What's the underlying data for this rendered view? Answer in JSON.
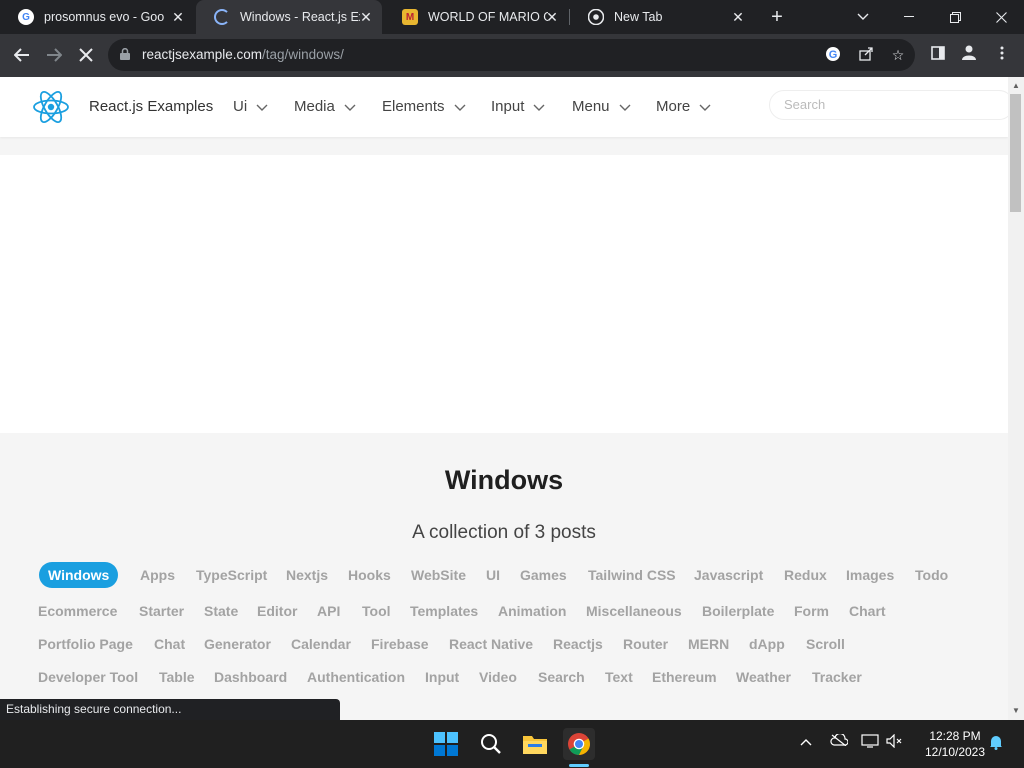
{
  "browser": {
    "tabs": [
      {
        "title": "prosomnus evo - Goog",
        "favicon": "google-icon",
        "active": false
      },
      {
        "title": "Windows - React.js Exa",
        "favicon": "loading-icon",
        "active": true
      },
      {
        "title": "WORLD OF MARIO GA",
        "favicon": "mario-icon",
        "active": false
      },
      {
        "title": "New Tab",
        "favicon": "chrome-icon",
        "active": false
      }
    ],
    "new_tab_symbol": "+",
    "url_domain": "reactjsexample.com",
    "url_path": "/tag/windows/",
    "status_text": "Establishing secure connection..."
  },
  "site": {
    "brand": "React.js Examples",
    "menu": [
      "Ui",
      "Media",
      "Elements",
      "Input",
      "Menu",
      "More"
    ],
    "search_placeholder": "Search",
    "heading": "Windows",
    "subheading": "A collection of 3 posts",
    "tags": [
      [
        "Windows",
        "Apps",
        "TypeScript",
        "Nextjs",
        "Hooks",
        "WebSite",
        "UI",
        "Games",
        "Tailwind CSS",
        "Javascript",
        "Redux",
        "Images",
        "Todo"
      ],
      [
        "Ecommerce",
        "Starter",
        "State",
        "Editor",
        "API",
        "Tool",
        "Templates",
        "Animation",
        "Miscellaneous",
        "Boilerplate",
        "Form",
        "Chart"
      ],
      [
        "Portfolio Page",
        "Chat",
        "Generator",
        "Calendar",
        "Firebase",
        "React Native",
        "Reactjs",
        "Router",
        "MERN",
        "dApp",
        "Scroll"
      ],
      [
        "Developer Tool",
        "Table",
        "Dashboard",
        "Authentication",
        "Input",
        "Video",
        "Search",
        "Text",
        "Ethereum",
        "Weather",
        "Tracker"
      ]
    ],
    "active_tag": "Windows",
    "accent_color": "#1a9fe0"
  },
  "taskbar": {
    "time": "12:28 PM",
    "date": "12/10/2023"
  }
}
